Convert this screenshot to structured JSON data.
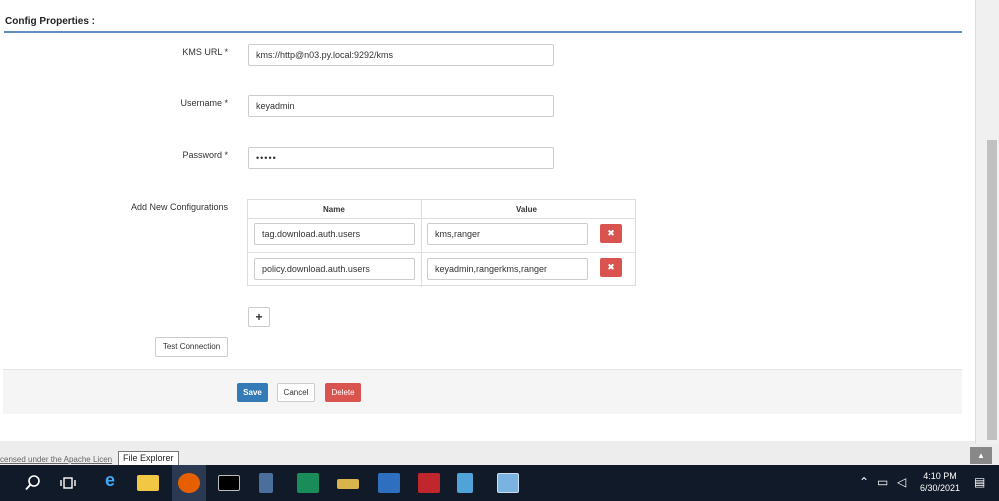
{
  "section": {
    "title": "Config Properties :"
  },
  "form": {
    "kms_url": {
      "label": "KMS URL *",
      "value": "kms://http@n03.py.local:9292/kms"
    },
    "username": {
      "label": "Username *",
      "value": "keyadmin"
    },
    "password": {
      "label": "Password *",
      "value": "•••••"
    },
    "add_new": {
      "label": "Add New Configurations"
    }
  },
  "config_table": {
    "headers": {
      "name": "Name",
      "value": "Value"
    },
    "rows": [
      {
        "name": "tag.download.auth.users",
        "value": "kms,ranger"
      },
      {
        "name": "policy.download.auth.users",
        "value": "keyadmin,rangerkms,ranger"
      }
    ],
    "delete_glyph": "✖",
    "add_glyph": "+"
  },
  "buttons": {
    "test_connection": "Test Connection",
    "save": "Save",
    "cancel": "Cancel",
    "delete": "Delete"
  },
  "footer": {
    "license_text": "censed under the Apache Licen",
    "tooltip": "File Explorer",
    "scroll_top_glyph": "▲"
  },
  "taskbar": {
    "time": "4:10 PM",
    "date": "6/30/2021",
    "icons": [
      "search-icon",
      "task-view-icon",
      "internet-explorer-icon",
      "file-explorer-icon",
      "firefox-icon",
      "terminal-icon",
      "network-icon",
      "hdp-icon",
      "folder-icon",
      "server-icon",
      "media-icon",
      "notepad-icon",
      "remote-desktop-icon"
    ]
  },
  "colors": {
    "primary": "#337ab7",
    "danger": "#d9534f",
    "section_rule": "#5f8fbf",
    "taskbar": "#111a28"
  }
}
